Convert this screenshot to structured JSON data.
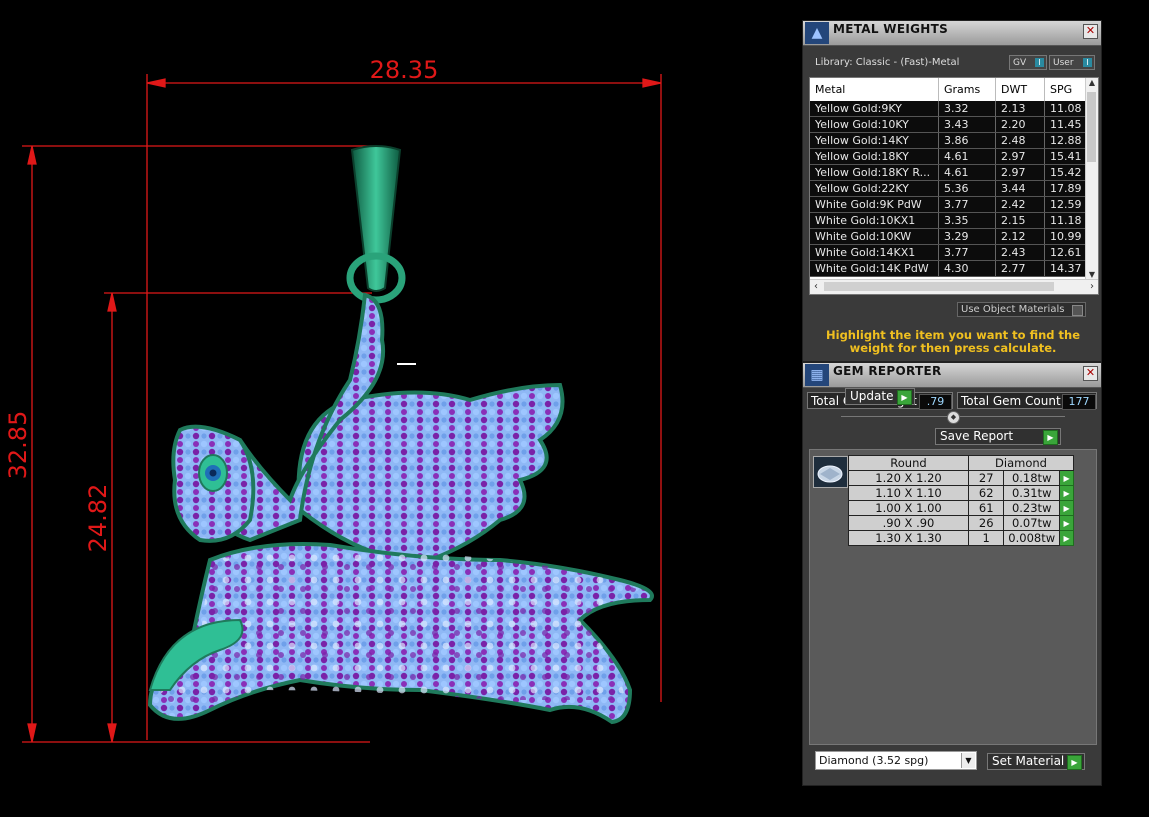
{
  "viewport": {
    "dim_width": "28.35",
    "dim_height_total": "32.85",
    "dim_height_body": "24.82"
  },
  "metal_weights": {
    "title": "METAL WEIGHTS",
    "library": "Library: Classic - (Fast)-Metal",
    "gv_label": "GV",
    "user_label": "User",
    "columns": [
      "Metal",
      "Grams",
      "DWT",
      "SPG"
    ],
    "rows": [
      [
        "Yellow Gold:9KY",
        "3.32",
        "2.13",
        "11.08"
      ],
      [
        "Yellow Gold:10KY",
        "3.43",
        "2.20",
        "11.45"
      ],
      [
        "Yellow Gold:14KY",
        "3.86",
        "2.48",
        "12.88"
      ],
      [
        "Yellow Gold:18KY",
        "4.61",
        "2.97",
        "15.41"
      ],
      [
        "Yellow Gold:18KY R...",
        "4.61",
        "2.97",
        "15.42"
      ],
      [
        "Yellow Gold:22KY",
        "5.36",
        "3.44",
        "17.89"
      ],
      [
        "White Gold:9K PdW",
        "3.77",
        "2.42",
        "12.59"
      ],
      [
        "White Gold:10KX1",
        "3.35",
        "2.15",
        "11.18"
      ],
      [
        "White Gold:10KW",
        "3.29",
        "2.12",
        "10.99"
      ],
      [
        "White Gold:14KX1",
        "3.77",
        "2.43",
        "12.61"
      ],
      [
        "White Gold:14K PdW",
        "4.30",
        "2.77",
        "14.37"
      ]
    ],
    "use_object_materials": "Use Object Materials",
    "hint": "Highlight the item you want to find the weight for then press calculate."
  },
  "gem_reporter": {
    "title": "GEM REPORTER",
    "total_weight_label": "Total Gem Weight",
    "total_weight_value": ".79",
    "total_count_label": "Total Gem Count",
    "total_count_value": "177",
    "update_label": "Update",
    "save_report_label": "Save Report",
    "table_headers": [
      "Round",
      "Diamond"
    ],
    "rows": [
      [
        "1.20 X 1.20",
        "27",
        "0.18tw"
      ],
      [
        "1.10 X 1.10",
        "62",
        "0.31tw"
      ],
      [
        "1.00 X 1.00",
        "61",
        "0.23tw"
      ],
      [
        ".90 X .90",
        "26",
        "0.07tw"
      ],
      [
        "1.30 X 1.30",
        "1",
        "0.008tw"
      ]
    ],
    "material_select": "Diamond    (3.52 spg)",
    "set_material_label": "Set Material"
  },
  "colors": {
    "dimension": "#e01818",
    "metal": "#1f7a5c",
    "gem_light": "#8fb8f5",
    "gem_purple": "#7a22a8",
    "hint": "#f0c020",
    "play": "#3aa53a"
  }
}
